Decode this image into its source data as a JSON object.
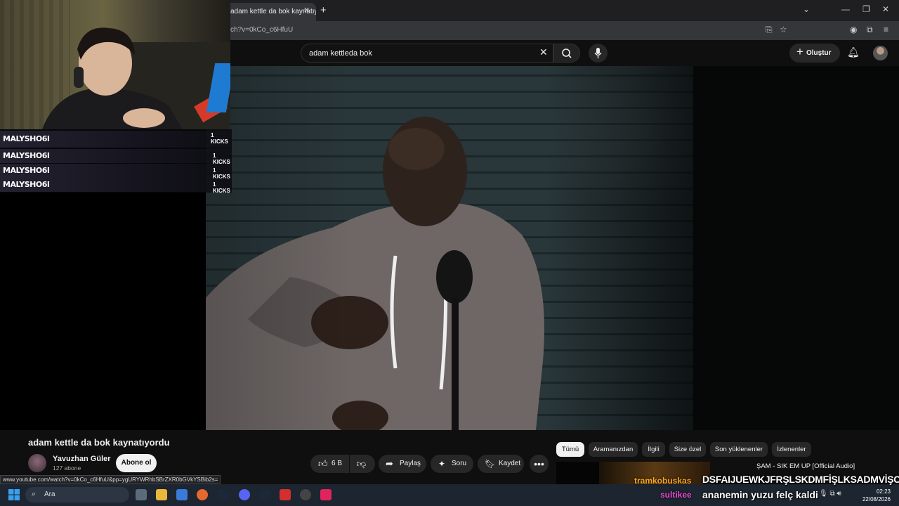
{
  "browser": {
    "tab_title": "adam kettle da bok kaynatıyordu",
    "url_visible": "ch?v=0kCo_c6HfuU",
    "status_url": "www.youtube.com/watch?v=0kCo_c6HfuU&pp=ygURYWRhbSBrZXR0bGVkYSBib2s="
  },
  "youtube": {
    "search_value": "adam kettleda bok",
    "create_label": "Oluştur",
    "video": {
      "title": "adam kettle da bok kaynatıyordu",
      "channel": "Yavuzhan Güler",
      "subscribers": "127 abone",
      "subscribe_label": "Abone ol",
      "likes": "6 B",
      "share_label": "Paylaş",
      "ask_label": "Soru",
      "save_label": "Kaydet"
    },
    "chips": [
      "Tümü",
      "Aramanızdan",
      "İlgili",
      "Size özel",
      "Son yüklenenler",
      "İzlenenler"
    ],
    "recommendation": {
      "title": "ŞAM - SIK EM UP [Official Audio]"
    }
  },
  "stream_overlay": {
    "chat": [
      {
        "name": "MALYSHO6I",
        "note": "1 KICKS"
      },
      {
        "name": "MALYSHO6I",
        "note": "1 KICKS"
      },
      {
        "name": "MALYSHO6I",
        "note": "1 KICKS"
      },
      {
        "name": "MALYSHO6I",
        "note": "1 KICKS"
      }
    ],
    "alert_user_1": "tramkobuskas",
    "alert_message_1": "DSFAIJUEWKJFRŞLSKDMFİŞLKSADMVİŞCV",
    "alert_user_2": "sultikee",
    "alert_message_2": "ananemin yuzu felç kaldi"
  },
  "taskbar": {
    "search_label": "Ara",
    "time": "02:23",
    "date": "22/08/2026"
  },
  "colors": {
    "background": "#0f0f0f",
    "chip_active": "#f1f1f1",
    "pill": "#272727",
    "taskbar": "#1c2530"
  }
}
